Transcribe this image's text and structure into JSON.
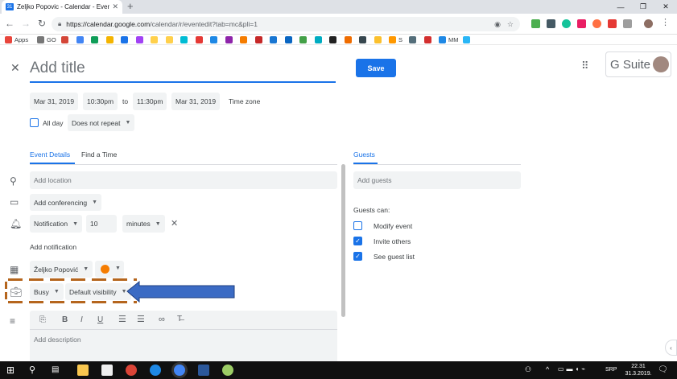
{
  "browser": {
    "tab_title": "Zeljko Popovic - Calendar - Event",
    "tab_favicon_text": "31",
    "new_tab_symbol": "+",
    "url_host": "https://calendar.google.com",
    "url_path": "/calendar/r/eventedit?tab=mc&pli=1"
  },
  "bookmarks": [
    {
      "label": "Apps",
      "color": "#e8453c"
    },
    {
      "label": "GO",
      "color": "#777777"
    },
    {
      "label": "",
      "color": "#d44638"
    },
    {
      "label": "",
      "color": "#4285f4"
    },
    {
      "label": "",
      "color": "#0f9d58"
    },
    {
      "label": "",
      "color": "#f4b400"
    },
    {
      "label": "",
      "color": "#1a73e8"
    },
    {
      "label": "",
      "color": "#a142f4"
    },
    {
      "label": "",
      "color": "#ffd04b"
    },
    {
      "label": "",
      "color": "#ffd04b"
    },
    {
      "label": "",
      "color": "#00bcd4"
    },
    {
      "label": "",
      "color": "#e53935"
    },
    {
      "label": "",
      "color": "#1e88e5"
    },
    {
      "label": "",
      "color": "#8e24aa"
    },
    {
      "label": "",
      "color": "#f57c00"
    },
    {
      "label": "",
      "color": "#c62828"
    },
    {
      "label": "",
      "color": "#1976d2"
    },
    {
      "label": "",
      "color": "#0a66c2"
    },
    {
      "label": "",
      "color": "#43a047"
    },
    {
      "label": "",
      "color": "#00acc1"
    },
    {
      "label": "",
      "color": "#212121"
    },
    {
      "label": "",
      "color": "#ef6c00"
    },
    {
      "label": "",
      "color": "#37474f"
    },
    {
      "label": "",
      "color": "#fbc02d"
    },
    {
      "label": "S",
      "color": "#ff9800"
    },
    {
      "label": "",
      "color": "#546e7a"
    },
    {
      "label": "",
      "color": "#d32f2f"
    },
    {
      "label": "MM",
      "color": "#1e88e5"
    },
    {
      "label": "",
      "color": "#29b6f6"
    }
  ],
  "event": {
    "close_symbol": "✕",
    "title_placeholder": "Add title",
    "save_label": "Save",
    "start_date": "Mar 31, 2019",
    "start_time": "10:30pm",
    "to_label": "to",
    "end_time": "11:30pm",
    "end_date": "Mar 31, 2019",
    "timezone_label": "Time zone",
    "allday_label": "All day",
    "repeat_label": "Does not repeat"
  },
  "details": {
    "tab_event_details": "Event Details",
    "tab_find_time": "Find a Time",
    "location_placeholder": "Add location",
    "conferencing_label": "Add conferencing",
    "notification_type": "Notification",
    "notification_value": "10",
    "notification_unit": "minutes",
    "add_notification": "Add notification",
    "calendar_owner": "Željko Popović",
    "calendar_color": "#f57c00",
    "busy_label": "Busy",
    "visibility_label": "Default visibility",
    "description_placeholder": "Add description"
  },
  "guests": {
    "tab_label": "Guests",
    "add_placeholder": "Add guests",
    "can_label": "Guests can:",
    "permissions": [
      {
        "label": "Modify event",
        "checked": false
      },
      {
        "label": "Invite others",
        "checked": true
      },
      {
        "label": "See guest list",
        "checked": true
      }
    ]
  },
  "gsuite": {
    "label": "G Suite"
  },
  "taskbar": {
    "time": "22.31",
    "date": "31.3.2019.",
    "lang": "SRP"
  },
  "colors": {
    "accent": "#1a73e8",
    "annotation_arrow": "#3b6bc4",
    "annotation_dash": "#b5651d"
  }
}
